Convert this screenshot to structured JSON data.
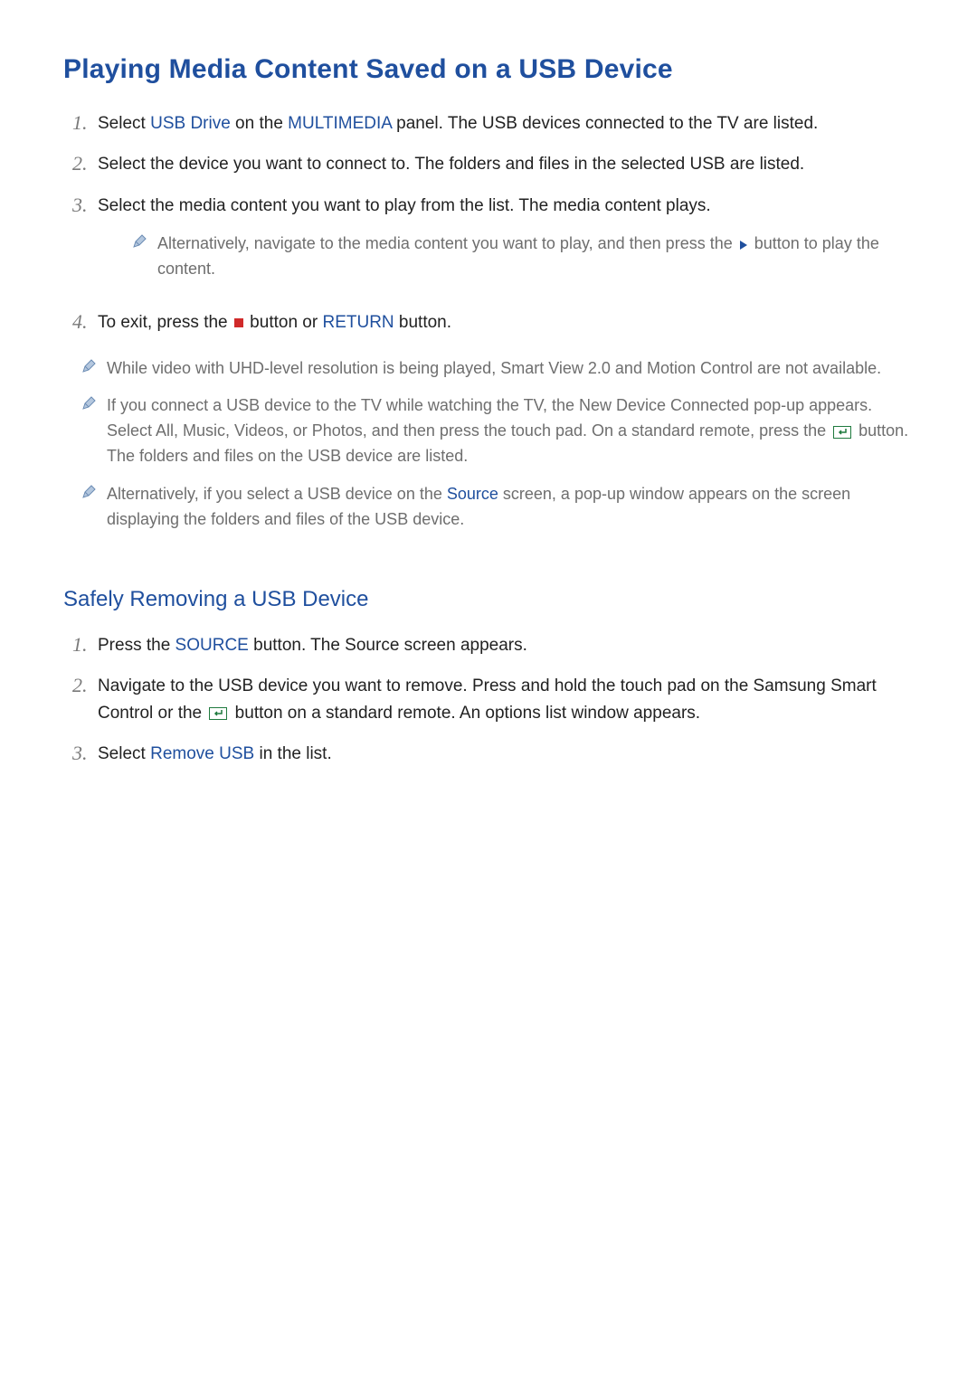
{
  "title": "Playing Media Content Saved on a USB Device",
  "steps1": {
    "s1": {
      "num": "1.",
      "t0": "Select ",
      "hl1": "USB Drive",
      "t1": " on the ",
      "hl2": "MULTIMEDIA",
      "t2": " panel. The USB devices connected to the TV are listed."
    },
    "s2": {
      "num": "2.",
      "t0": "Select the device you want to connect to. The folders and files in the selected USB are listed."
    },
    "s3": {
      "num": "3.",
      "t0": "Select the media content you want to play from the list. The media content plays.",
      "note_a": "Alternatively, navigate to the media content you want to play, and then press the ",
      "note_b": " button to play the content."
    },
    "s4": {
      "num": "4.",
      "t0": "To exit, press the ",
      "t1": " button or ",
      "hl1": "RETURN",
      "t2": " button."
    }
  },
  "notes": {
    "n1": "While video with UHD-level resolution is being played, Smart View 2.0 and Motion Control are not available.",
    "n2_a": "If you connect a USB device to the TV while watching the TV, the New Device Connected pop-up appears. Select All, Music, Videos, or Photos, and then press the touch pad. On a standard remote, press the ",
    "n2_b": " button. The folders and files on the USB device are listed.",
    "n3_a": "Alternatively, if you select a USB device on the ",
    "n3_hl": "Source",
    "n3_b": " screen, a pop-up window appears on the screen displaying the folders and files of the USB device."
  },
  "subtitle": "Safely Removing a USB Device",
  "steps2": {
    "s1": {
      "num": "1.",
      "t0": "Press the ",
      "hl1": "SOURCE",
      "t1": " button. The Source screen appears."
    },
    "s2": {
      "num": "2.",
      "t0": "Navigate to the USB device you want to remove. Press and hold the touch pad on the Samsung Smart Control or the ",
      "t1": " button on a standard remote. An options list window appears."
    },
    "s3": {
      "num": "3.",
      "t0": "Select ",
      "hl1": "Remove USB",
      "t1": " in the list."
    }
  }
}
